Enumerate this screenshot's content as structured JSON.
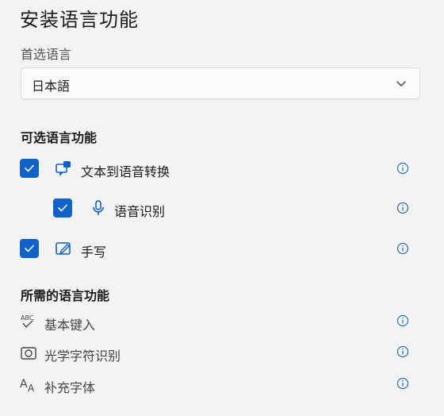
{
  "title": "安装语言功能",
  "preferred": {
    "label": "首选语言",
    "selected": "日本語"
  },
  "optional": {
    "heading": "可选语言功能",
    "items": [
      {
        "label": "文本到语音转换",
        "checked": true,
        "icon": "text-to-speech-icon"
      },
      {
        "label": "语音识别",
        "checked": true,
        "icon": "microphone-icon"
      },
      {
        "label": "手写",
        "checked": true,
        "icon": "pen-tablet-icon"
      }
    ]
  },
  "required": {
    "heading": "所需的语言功能",
    "items": [
      {
        "label": "基本键入",
        "icon": "spell-check-icon"
      },
      {
        "label": "光学字符识别",
        "icon": "ocr-icon"
      },
      {
        "label": "补充字体",
        "icon": "font-icon"
      }
    ]
  },
  "colors": {
    "accent": "#0f62c8",
    "info": "#2b6fb8"
  }
}
